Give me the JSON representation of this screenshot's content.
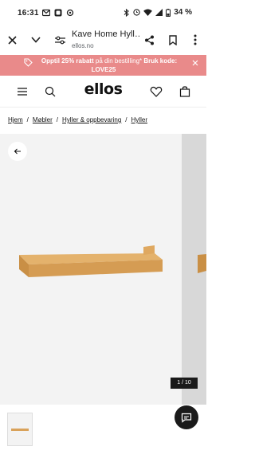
{
  "status_bar": {
    "time": "16:31",
    "battery": "34 %"
  },
  "browser": {
    "page_title": "Kave Home Hyll…",
    "url": "ellos.no"
  },
  "promo": {
    "text_bold": "Opptil 25% rabatt",
    "text_regular": " på din bestilling* ",
    "text_code_label": "Bruk kode:",
    "code": "LOVE25"
  },
  "header": {
    "logo": "ellos"
  },
  "breadcrumb": {
    "items": [
      "Hjem",
      "Møbler",
      "Hyller & oppbevaring",
      "Hyller"
    ],
    "separator": "/"
  },
  "gallery": {
    "counter": "1 / 10"
  },
  "colors": {
    "promo_bg": "#e98a8a",
    "shelf_wood": "#d9a25a"
  }
}
